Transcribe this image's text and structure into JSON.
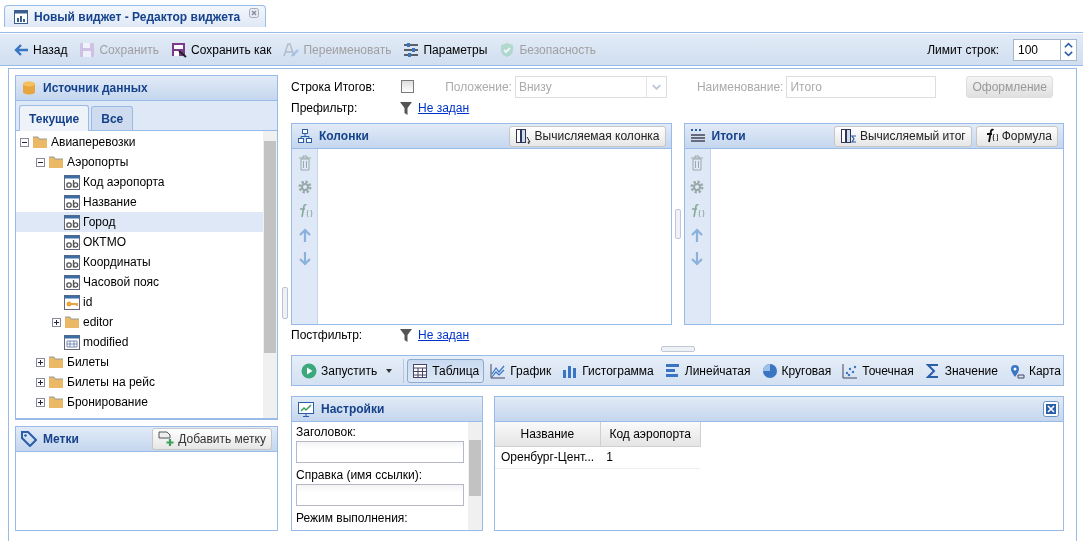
{
  "window_tab": {
    "title": "Новый виджет - Редактор виджета"
  },
  "toolbar": {
    "buttons": [
      {
        "label": "Назад",
        "kind": "back",
        "disabled": false
      },
      {
        "label": "Сохранить",
        "kind": "save",
        "disabled": true
      },
      {
        "label": "Сохранить как",
        "kind": "save_as",
        "disabled": false
      },
      {
        "label": "Переименовать",
        "kind": "rename",
        "disabled": true
      },
      {
        "label": "Параметры",
        "kind": "params",
        "disabled": false
      },
      {
        "label": "Безопасность",
        "kind": "security",
        "disabled": true
      }
    ],
    "row_limit": {
      "label": "Лимит строк:",
      "value": "100"
    }
  },
  "data_source": {
    "title": "Источник данных",
    "tabs": [
      {
        "label": "Текущие",
        "selected": true
      },
      {
        "label": "Все",
        "selected": false
      }
    ],
    "tree": [
      {
        "label": "Авиаперевозки",
        "kind": "folder",
        "expanded": true,
        "selected": false,
        "children": [
          {
            "label": "Аэропорты",
            "kind": "folder",
            "expanded": true,
            "selected": false,
            "children": [
              {
                "label": "Код аэропорта",
                "kind": "text",
                "selected": false
              },
              {
                "label": "Название",
                "kind": "text",
                "selected": false
              },
              {
                "label": "Город",
                "kind": "text",
                "selected": true
              },
              {
                "label": "ОКТМО",
                "kind": "text",
                "selected": false
              },
              {
                "label": "Координаты",
                "kind": "text",
                "selected": false
              },
              {
                "label": "Часовой пояс",
                "kind": "text",
                "selected": false
              },
              {
                "label": "id",
                "kind": "key",
                "selected": false
              },
              {
                "label": "editor",
                "kind": "folder",
                "expanded": false,
                "selected": false
              },
              {
                "label": "modified",
                "kind": "date",
                "selected": false
              }
            ]
          },
          {
            "label": "Билеты",
            "kind": "folder",
            "expanded": false,
            "selected": false
          },
          {
            "label": "Билеты на рейс",
            "kind": "folder",
            "expanded": false,
            "selected": false
          },
          {
            "label": "Бронирование",
            "kind": "folder",
            "expanded": false,
            "selected": false
          }
        ]
      }
    ]
  },
  "tags": {
    "title": "Метки",
    "add_button": "Добавить метку"
  },
  "totals_row": {
    "label": "Строка Итогов:",
    "checked": false,
    "options_disabled": true,
    "position_label": "Положение:",
    "position_value": "Внизу",
    "name_label": "Наименование:",
    "name_value": "Итого",
    "style_button": "Оформление"
  },
  "prefilter": {
    "label": "Префильтр:",
    "link": "Не задан"
  },
  "columns_panel": {
    "title": "Колонки",
    "buttons": [
      {
        "label": "Вычисляемая колонка",
        "kind": "calc_column"
      }
    ]
  },
  "totals_panel": {
    "title": "Итоги",
    "buttons": [
      {
        "label": "Вычисляемый итог",
        "kind": "calc_total"
      },
      {
        "label": "Формула",
        "kind": "formula"
      }
    ]
  },
  "postfilter": {
    "label": "Постфильтр:",
    "link": "Не задан"
  },
  "view_toolbar": {
    "run_button": "Запустить",
    "views": [
      {
        "label": "Таблица",
        "kind": "table",
        "selected": true
      },
      {
        "label": "График",
        "kind": "line",
        "selected": false
      },
      {
        "label": "Гистограмма",
        "kind": "histogram",
        "selected": false
      },
      {
        "label": "Линейчатая",
        "kind": "hbar",
        "selected": false
      },
      {
        "label": "Круговая",
        "kind": "pie",
        "selected": false
      },
      {
        "label": "Точечная",
        "kind": "scatter",
        "selected": false
      },
      {
        "label": "Значение",
        "kind": "value",
        "selected": false
      },
      {
        "label": "Карта",
        "kind": "map",
        "selected": false
      }
    ]
  },
  "settings": {
    "title": "Настройки",
    "fields": [
      {
        "label": "Заголовок:"
      },
      {
        "label": "Справка (имя ссылки):"
      }
    ],
    "next_label": "Режим выполнения:"
  },
  "preview": {
    "columns": [
      "Название",
      "Код аэропорта"
    ],
    "rows": [
      [
        "Оренбург-Цент...",
        "1"
      ]
    ]
  }
}
